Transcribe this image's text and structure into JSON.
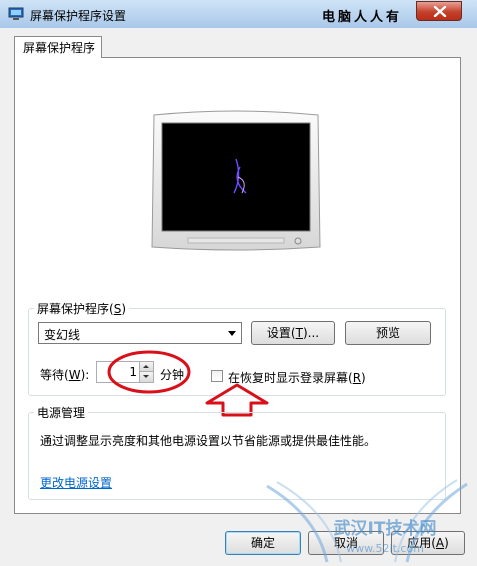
{
  "window": {
    "title": "屏幕保护程序设置",
    "watermark": "电脑人人有"
  },
  "tabs": [
    {
      "label": "屏幕保护程序"
    }
  ],
  "screensaver": {
    "group_label": "屏幕保护程序",
    "group_label_key": "S",
    "selected": "变幻线",
    "settings_label": "设置",
    "settings_key": "T",
    "preview_label": "预览",
    "wait_label": "等待",
    "wait_key": "W",
    "wait_value": "1",
    "minutes_label": "分钟",
    "resume_label": "在恢复时显示登录屏幕",
    "resume_key": "R",
    "resume_checked": false
  },
  "power": {
    "group_label": "电源管理",
    "description": "通过调整显示亮度和其他电源设置以节省能源或提供最佳性能。",
    "link": "更改电源设置"
  },
  "footer": {
    "ok": "确定",
    "cancel": "取消",
    "apply": "应用",
    "apply_key": "A"
  },
  "site_watermark": {
    "brand": "武汉IT技术网",
    "url": "www.52it.com"
  },
  "annotations": {
    "circle_color": "#d7101a",
    "arrow_color": "#d7101a"
  }
}
